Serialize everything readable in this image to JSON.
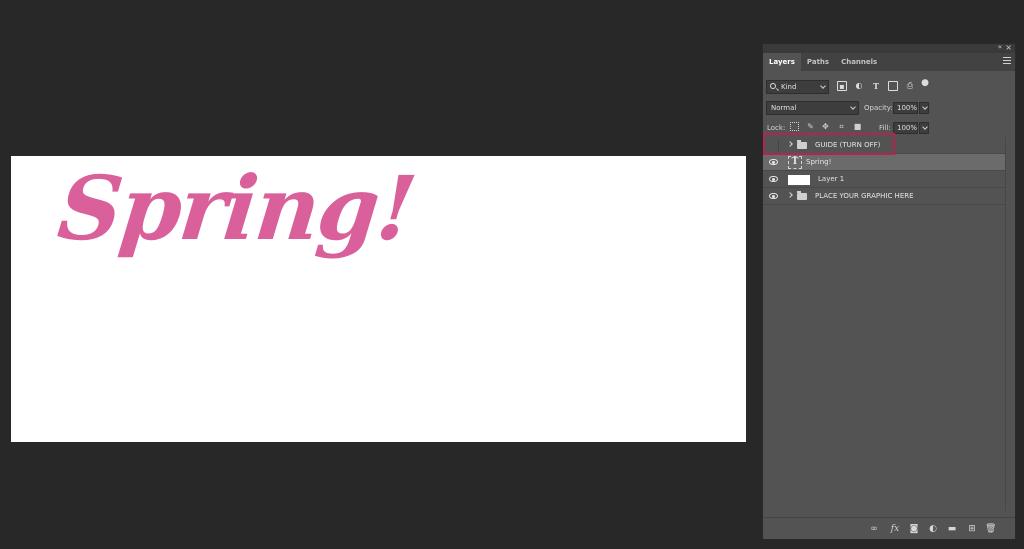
{
  "canvas": {
    "headline": "Spring!",
    "headline_color": "#d9609a",
    "background": "#ffffff"
  },
  "panel": {
    "tabs": [
      {
        "label": "Layers",
        "active": true
      },
      {
        "label": "Paths",
        "active": false
      },
      {
        "label": "Channels",
        "active": false
      }
    ],
    "filter": {
      "kind_label": "Kind",
      "icons": [
        "image-filter-icon",
        "adjustment-filter-icon",
        "type-filter-icon",
        "shape-filter-icon",
        "smart-object-filter-icon",
        "filter-toggle-icon"
      ]
    },
    "blend_mode": "Normal",
    "opacity_label": "Opacity:",
    "opacity_value": "100%",
    "lock_label": "Lock:",
    "lock_icons": [
      "lock-transparent-icon",
      "lock-image-icon",
      "lock-position-icon",
      "lock-artboard-icon",
      "lock-all-icon"
    ],
    "fill_label": "Fill:",
    "fill_value": "100%",
    "layers": [
      {
        "name": "GUIDE (TURN OFF)",
        "type": "group",
        "visible": false,
        "selected": false
      },
      {
        "name": "Spring!",
        "type": "text",
        "visible": true,
        "selected": true
      },
      {
        "name": "Layer 1",
        "type": "pixel",
        "visible": true,
        "selected": false
      },
      {
        "name": "PLACE YOUR GRAPHIC HERE",
        "type": "group",
        "visible": true,
        "selected": false
      }
    ],
    "highlight_color": "#b0264e",
    "bottom_icons": [
      "link-layers-icon",
      "fx-icon",
      "add-mask-icon",
      "adjustment-layer-icon",
      "new-group-icon",
      "new-layer-icon",
      "trash-icon"
    ]
  }
}
